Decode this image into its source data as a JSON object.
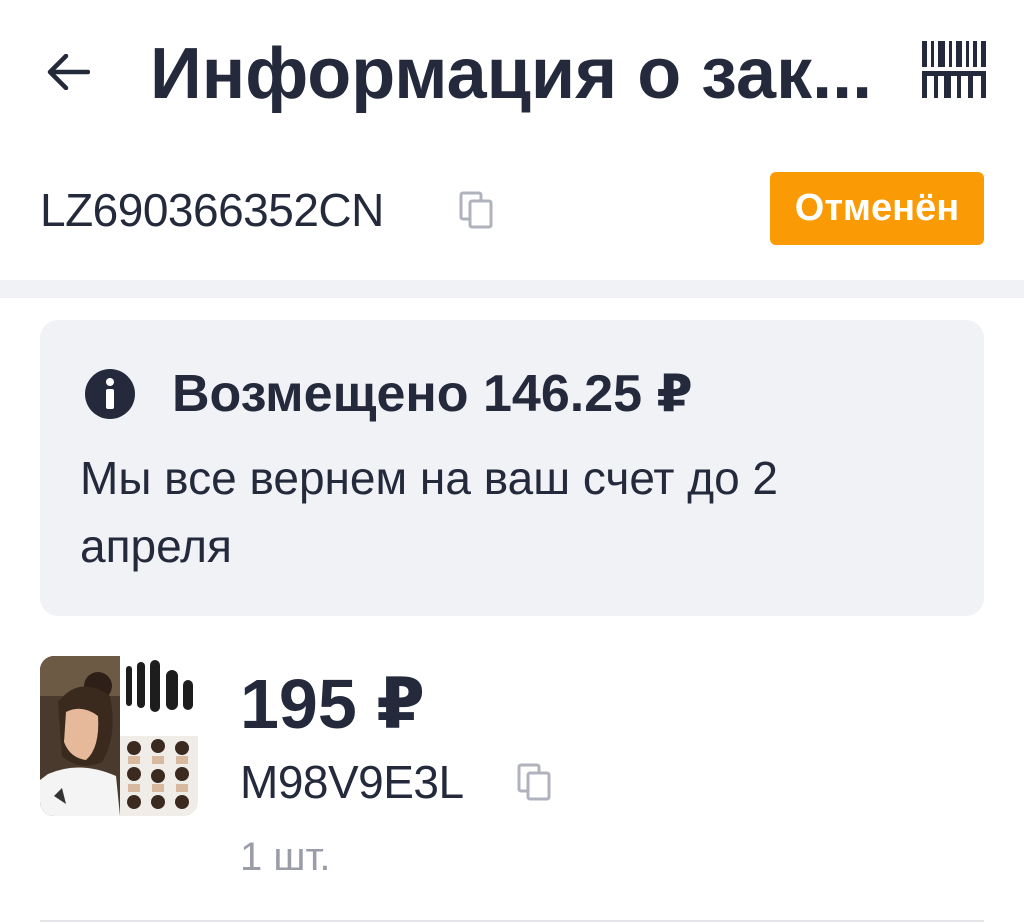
{
  "header": {
    "title": "Информация о зак..."
  },
  "order": {
    "tracking_number": "LZ690366352CN",
    "status": "Отменён",
    "status_color": "#fa9a05"
  },
  "refund": {
    "title": "Возмещено 146.25 ₽",
    "message": "Мы все вернем на ваш счет до 2 апреля"
  },
  "product": {
    "price": "195 ₽",
    "sku": "M98V9E3L",
    "quantity": "1 шт."
  },
  "colors": {
    "text": "#242a3c",
    "muted": "#9a9ca7",
    "panel": "#f1f2f6",
    "accent": "#fa9a05"
  },
  "icons": {
    "back": "arrow-left-icon",
    "barcode": "barcode-icon",
    "copy": "copy-icon",
    "info": "info-icon"
  }
}
